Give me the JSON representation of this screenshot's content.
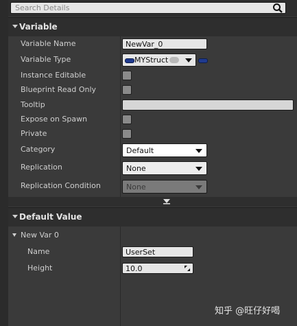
{
  "search": {
    "placeholder": "Search Details"
  },
  "variable_section": {
    "title": "Variable",
    "rows": {
      "name_label": "Variable Name",
      "name_value": "NewVar_0",
      "type_label": "Variable Type",
      "type_value": "MYStruct",
      "instance_editable_label": "Instance Editable",
      "blueprint_read_only_label": "Blueprint Read Only",
      "tooltip_label": "Tooltip",
      "tooltip_value": "",
      "expose_on_spawn_label": "Expose on Spawn",
      "private_label": "Private",
      "category_label": "Category",
      "category_value": "Default",
      "replication_label": "Replication",
      "replication_value": "None",
      "replication_condition_label": "Replication Condition",
      "replication_condition_value": "None"
    }
  },
  "default_section": {
    "title": "Default Value",
    "struct_label": "New Var 0",
    "fields": {
      "name_label": "Name",
      "name_value": "UserSet",
      "height_label": "Height",
      "height_value": "10.0"
    }
  },
  "watermark": "知乎 @旺仔好喝",
  "colors": {
    "panel_bg": "#3a3a3a",
    "header_bg": "#2e2e2e",
    "struct_pill": "#1f3a8f"
  }
}
